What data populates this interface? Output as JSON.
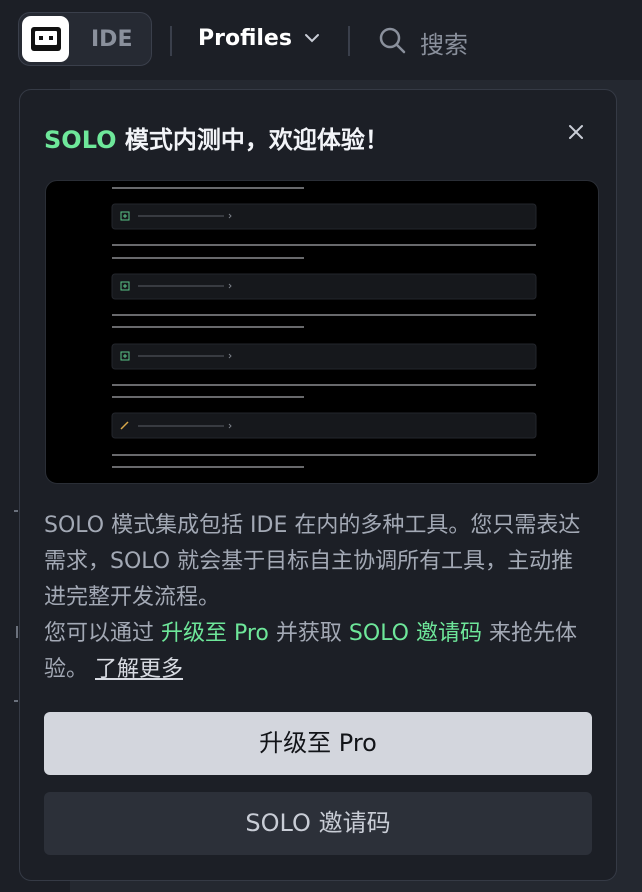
{
  "topbar": {
    "mode_label": "IDE",
    "profiles_label": "Profiles",
    "search_placeholder": "搜索"
  },
  "popover": {
    "title_accent": "SOLO",
    "title_rest": " 模式内测中，欢迎体验！",
    "description_line1": "SOLO 模式集成包括 IDE 在内的多种工具。您只需表达需求，SOLO 就会基于目标自主协调所有工具，主动推进完整开发流程。",
    "description_line2_prefix": "您可以通过 ",
    "description_line2_hl1": "升级至 Pro",
    "description_line2_mid": " 并获取 ",
    "description_line2_hl2": "SOLO 邀请码",
    "description_line2_suffix": " 来抢先体验。 ",
    "learn_more": "了解更多",
    "primary_button": "升级至 Pro",
    "secondary_button": "SOLO 邀请码"
  },
  "colors": {
    "accent_green": "#6ee79a",
    "background": "#1c1f26",
    "primary_button_bg": "#d3d6dd"
  },
  "icons": [
    "ide-mode-icon",
    "chevron-down-icon",
    "search-icon",
    "close-icon",
    "task-plus-icon",
    "pencil-icon"
  ]
}
